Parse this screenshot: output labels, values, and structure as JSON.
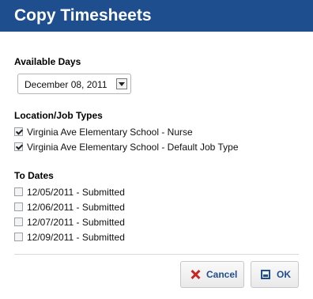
{
  "dialog": {
    "title": "Copy Timesheets"
  },
  "available_days": {
    "label": "Available Days",
    "selected": "December 08, 2011"
  },
  "location_job_types": {
    "label": "Location/Job Types",
    "items": [
      {
        "label": "Virginia Ave Elementary School - Nurse",
        "checked": true
      },
      {
        "label": "Virginia Ave Elementary School - Default Job Type",
        "checked": true
      }
    ]
  },
  "to_dates": {
    "label": "To Dates",
    "items": [
      {
        "label": "12/05/2011 - Submitted",
        "checked": false
      },
      {
        "label": "12/06/2011 - Submitted",
        "checked": false
      },
      {
        "label": "12/07/2011 - Submitted",
        "checked": false
      },
      {
        "label": "12/09/2011 - Submitted",
        "checked": false
      }
    ]
  },
  "buttons": {
    "cancel": "Cancel",
    "ok": "OK"
  },
  "colors": {
    "header": "#1f4e8e",
    "accent": "#1f4e8e",
    "cancel_icon": "#c62828"
  }
}
